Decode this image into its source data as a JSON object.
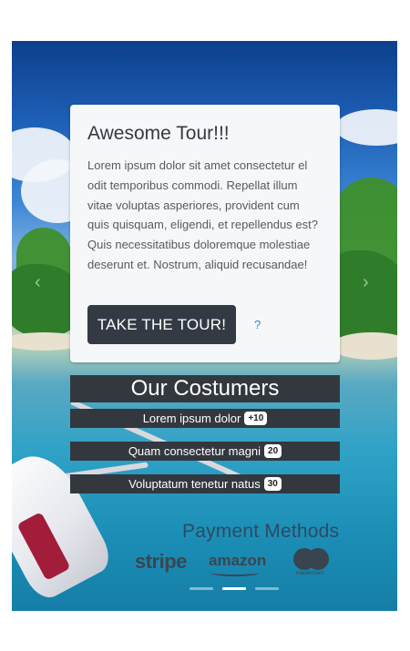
{
  "tour": {
    "title": "Awesome Tour!!!",
    "text": "Lorem ipsum dolor sit amet consectetur el odit temporibus commodi. Repellat illum vitae voluptas asperiores, provident cum quis quisquam, eligendi, et repellendus est? Quis necessitatibus doloremque molestiae deserunt et. Nostrum, aliquid recusandae!",
    "button_label": "TAKE THE TOUR!",
    "help_label": "?"
  },
  "costumers": {
    "title": "Our Costumers",
    "items": [
      {
        "label": "Lorem ipsum dolor",
        "badge": "+10"
      },
      {
        "label": "Quam consectetur magni",
        "badge": "20"
      },
      {
        "label": "Voluptatum tenetur natus",
        "badge": "30"
      }
    ]
  },
  "payment": {
    "title": "Payment Methods",
    "logos": {
      "stripe": "stripe",
      "amazon": "amazon",
      "mastercard": "mastercard"
    }
  },
  "carousel": {
    "prev_icon": "chevron-left-icon",
    "next_icon": "chevron-right-icon",
    "active_index": 1,
    "slide_count": 3
  },
  "colors": {
    "dark": "#33383f",
    "link": "#2b87d1",
    "card_bg": "#f6f7f9"
  }
}
